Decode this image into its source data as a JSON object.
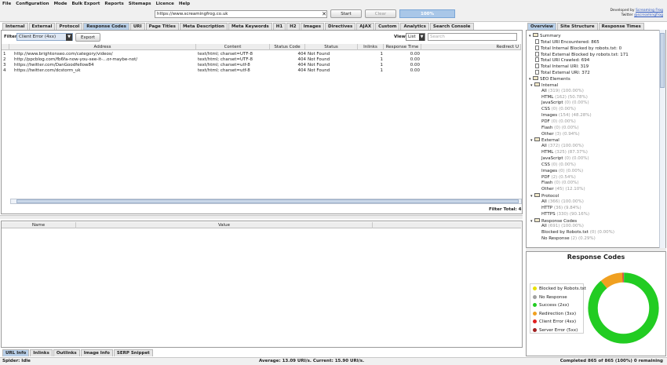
{
  "menu": [
    "File",
    "Configuration",
    "Mode",
    "Bulk Export",
    "Reports",
    "Sitemaps",
    "Licence",
    "Help"
  ],
  "toolbar": {
    "url": "https://www.screamingfrog.co.uk",
    "start": "Start",
    "clear": "Clear",
    "progress": "100%",
    "credit_line1": "Developed by",
    "credit_link1": "Screaming Frog",
    "credit_line2": "Twitter",
    "credit_link2": "@screamingfrog"
  },
  "tabs": [
    "Internal",
    "External",
    "Protocol",
    "Response Codes",
    "URI",
    "Page Titles",
    "Meta Description",
    "Meta Keywords",
    "H1",
    "H2",
    "Images",
    "Directives",
    "AJAX",
    "Custom",
    "Analytics",
    "Search Console"
  ],
  "active_tab": "Response Codes",
  "filter": {
    "label": "Filter:",
    "value": "Client Error (4xx)",
    "export": "Export",
    "view_label": "View:",
    "view_value": "List",
    "search_placeholder": "Search"
  },
  "table": {
    "columns": [
      "Address",
      "Content",
      "Status Code",
      "Status",
      "Inlinks",
      "Response Time",
      "Redirect U"
    ],
    "rows": [
      {
        "n": "1",
        "address": "http://www.brightonseo.com/category/videos/",
        "content": "text/html; charset=UTF-8",
        "code": "404",
        "status": "Not Found",
        "inlinks": "1",
        "time": "0.00"
      },
      {
        "n": "2",
        "address": "http://ppcblog.com/fb6fa-now-you-see-it-...or-maybe-not/",
        "content": "text/html; charset=UTF-8",
        "code": "404",
        "status": "Not Found",
        "inlinks": "1",
        "time": "0.00"
      },
      {
        "n": "3",
        "address": "https://twitter.com/DanGoodfellow84",
        "content": "text/html; charset=utf-8",
        "code": "404",
        "status": "Not Found",
        "inlinks": "1",
        "time": "0.00"
      },
      {
        "n": "4",
        "address": "https://twitter.com/dcstorm_uk",
        "content": "text/html; charset=utf-8",
        "code": "404",
        "status": "Not Found",
        "inlinks": "1",
        "time": "0.00"
      }
    ]
  },
  "filter_total": "Filter Total:  4",
  "lower": {
    "columns": [
      "Name",
      "Value"
    ]
  },
  "bottom_tabs": [
    "URL Info",
    "Inlinks",
    "Outlinks",
    "Image Info",
    "SERP Snippet"
  ],
  "status": {
    "left": "Spider: Idle",
    "mid": "Average: 13.09 URI/s. Current: 15.90 URI/s.",
    "right": "Completed 865 of 865 (100%) 0 remaining"
  },
  "right_tabs": [
    "Overview",
    "Site Structure",
    "Response Times"
  ],
  "tree": {
    "summary": "Summary",
    "summary_items": [
      "Total URI Encountered: 865",
      "Total Internal Blocked by robots.txt: 0",
      "Total External Blocked by robots.txt: 171",
      "Total URI Crawled: 694",
      "Total Internal URI: 319",
      "Total External URI: 372"
    ],
    "seo": "SEO Elements",
    "internal": "Internal",
    "internal_items": [
      [
        "All",
        "(319) (100.00%)"
      ],
      [
        "HTML",
        "(162) (50.78%)"
      ],
      [
        "JavaScript",
        "(0) (0.00%)"
      ],
      [
        "CSS",
        "(0) (0.00%)"
      ],
      [
        "Images",
        "(154) (48.28%)"
      ],
      [
        "PDF",
        "(0) (0.00%)"
      ],
      [
        "Flash",
        "(0) (0.00%)"
      ],
      [
        "Other",
        "(3) (0.94%)"
      ]
    ],
    "external": "External",
    "external_items": [
      [
        "All",
        "(372) (100.00%)"
      ],
      [
        "HTML",
        "(325) (87.37%)"
      ],
      [
        "JavaScript",
        "(0) (0.00%)"
      ],
      [
        "CSS",
        "(0) (0.00%)"
      ],
      [
        "Images",
        "(0) (0.00%)"
      ],
      [
        "PDF",
        "(2) (0.54%)"
      ],
      [
        "Flash",
        "(0) (0.00%)"
      ],
      [
        "Other",
        "(45) (12.10%)"
      ]
    ],
    "protocol": "Protocol",
    "protocol_items": [
      [
        "All",
        "(366) (100.00%)"
      ],
      [
        "HTTP",
        "(36) (9.84%)"
      ],
      [
        "HTTPS",
        "(330) (90.16%)"
      ]
    ],
    "response": "Response Codes",
    "response_items": [
      [
        "All",
        "(691) (100.00%)"
      ],
      [
        "Blocked by Robots.txt",
        "(0) (0.00%)"
      ],
      [
        "No Response",
        "(2) (0.29%)"
      ]
    ]
  },
  "chart_data": {
    "type": "pie",
    "title": "Response Codes",
    "categories": [
      "Blocked by Robots.txt",
      "No Response",
      "Success (2xx)",
      "Redirection (3xx)",
      "Client Error (4xx)",
      "Server Error (5xx)"
    ],
    "values": [
      0,
      0.29,
      88.5,
      10.6,
      0.58,
      0
    ],
    "colors": [
      "#e8e000",
      "#a0a0a0",
      "#22cc22",
      "#f0a020",
      "#e02020",
      "#a02020"
    ]
  }
}
